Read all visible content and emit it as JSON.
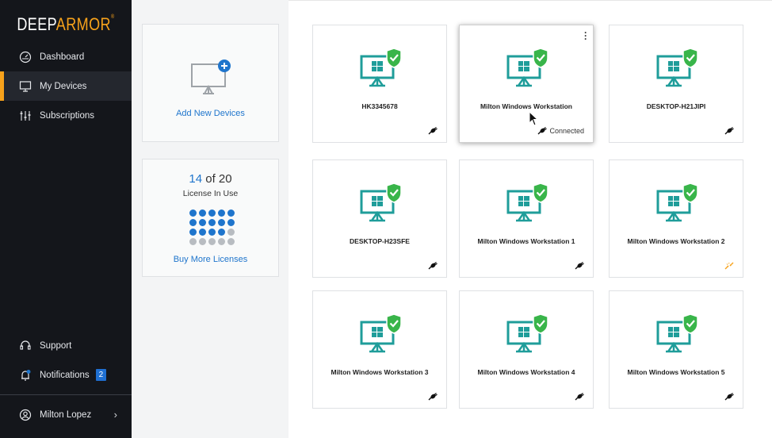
{
  "brand": {
    "part1": "DEEP",
    "part2": "ARMOR",
    "mark": "®"
  },
  "sidebar": {
    "items": [
      {
        "label": "Dashboard",
        "icon": "dashboard-gauge-icon",
        "active": false
      },
      {
        "label": "My Devices",
        "icon": "monitor-icon",
        "active": true
      },
      {
        "label": "Subscriptions",
        "icon": "sliders-icon",
        "active": false
      }
    ],
    "support_label": "Support",
    "notifications_label": "Notifications",
    "notifications_count": "2",
    "user_name": "Milton Lopez"
  },
  "add_devices": {
    "label": "Add New Devices"
  },
  "licenses": {
    "used": "14",
    "of_total": " of 20",
    "caption": "License In Use",
    "buy_label": "Buy More Licenses",
    "used_count": 14,
    "total_count": 20
  },
  "devices": [
    {
      "name": "HK3345678",
      "status": "offline"
    },
    {
      "name": "Milton Windows Workstation",
      "status": "connected",
      "status_label": "Connected",
      "selected": true
    },
    {
      "name": "DESKTOP-H21JIPI",
      "status": "offline"
    },
    {
      "name": "DESKTOP-H23SFE",
      "status": "offline"
    },
    {
      "name": "Milton Windows Workstation 1",
      "status": "offline"
    },
    {
      "name": "Milton Windows Workstation 2",
      "status": "warning"
    },
    {
      "name": "Milton Windows Workstation 3",
      "status": "offline"
    },
    {
      "name": "Milton Windows Workstation 4",
      "status": "offline"
    },
    {
      "name": "Milton Windows Workstation 5",
      "status": "offline"
    }
  ],
  "colors": {
    "sidebar_bg": "#14161b",
    "accent_orange": "#f7a21b",
    "link_blue": "#1f75cc",
    "monitor_teal": "#1f9d9a",
    "shield_green": "#39b54a"
  }
}
